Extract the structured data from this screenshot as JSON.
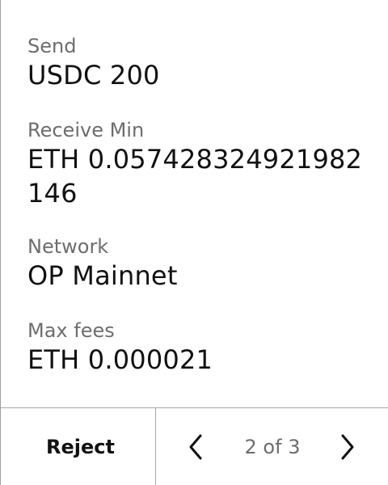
{
  "details": {
    "send": {
      "label": "Send",
      "value": "USDC 200"
    },
    "receive_min": {
      "label": "Receive Min",
      "value": "ETH 0.0574283249219​82146"
    },
    "network": {
      "label": "Network",
      "value": "OP Mainnet"
    },
    "max_fees": {
      "label": "Max fees",
      "value": "ETH 0.000021"
    }
  },
  "footer": {
    "reject_label": "Reject",
    "pagination": {
      "text": "2 of 3",
      "prev_icon": "chevron-left-icon",
      "next_icon": "chevron-right-icon"
    }
  }
}
